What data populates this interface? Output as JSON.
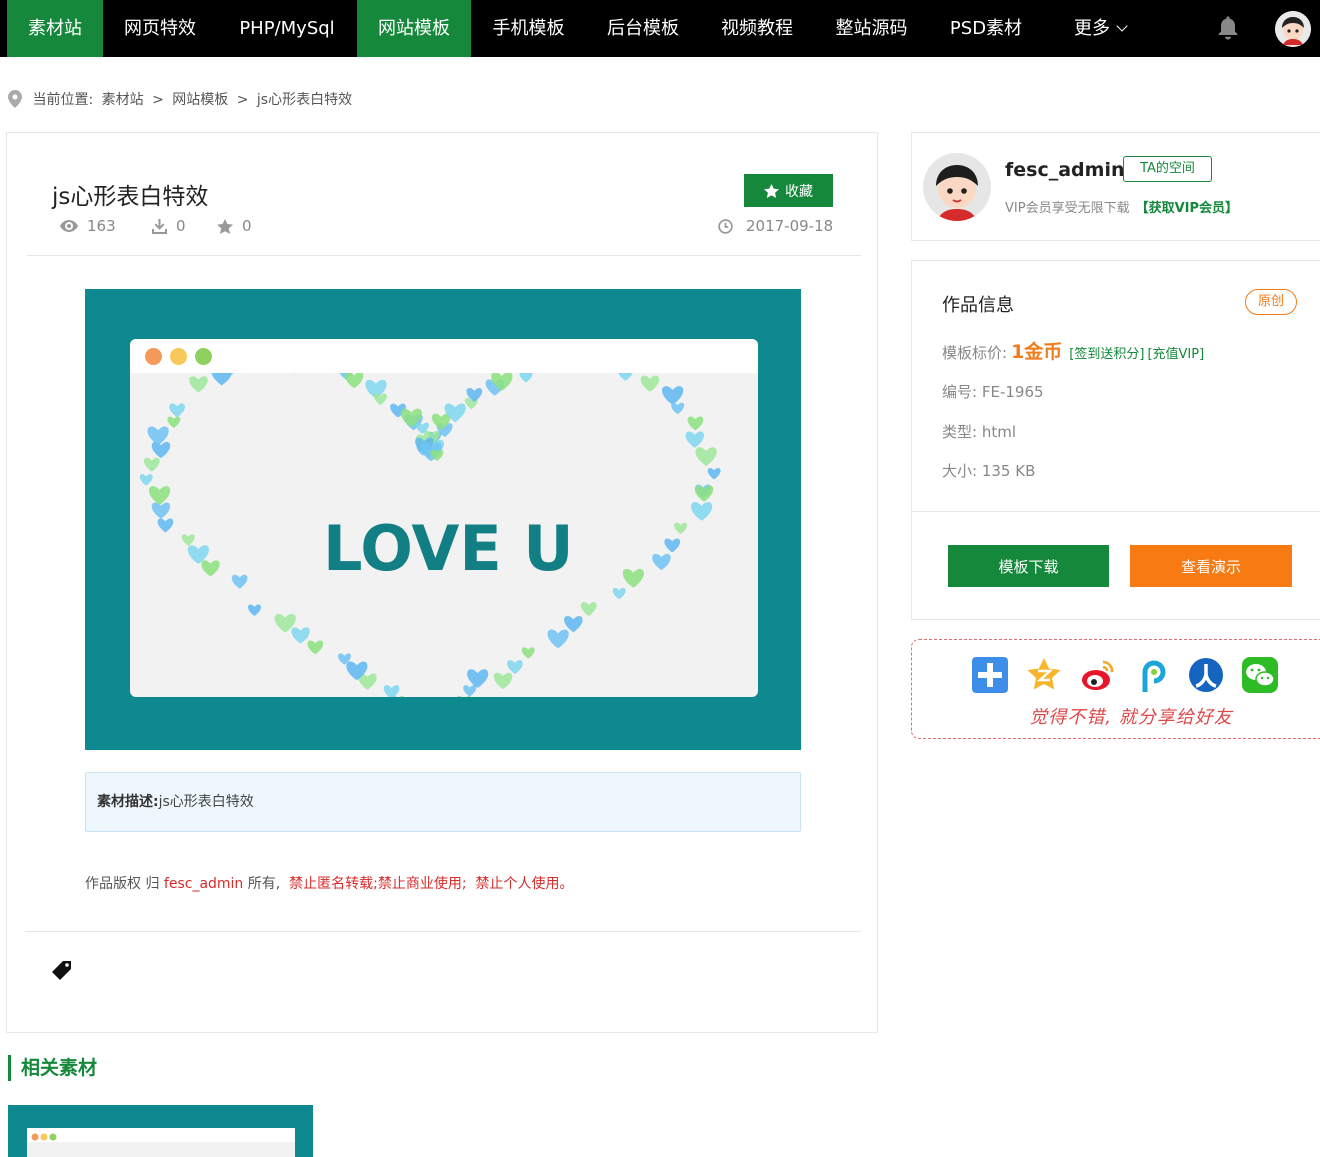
{
  "nav": {
    "items": [
      {
        "label": "素材站",
        "active": true
      },
      {
        "label": "网页特效",
        "active": false
      },
      {
        "label": "PHP/MySql",
        "active": false
      },
      {
        "label": "网站模板",
        "active": true
      },
      {
        "label": "手机模板",
        "active": false
      },
      {
        "label": "后台模板",
        "active": false
      },
      {
        "label": "视频教程",
        "active": false
      },
      {
        "label": "整站源码",
        "active": false
      },
      {
        "label": "PSD素材",
        "active": false
      },
      {
        "label": "更多",
        "active": false
      }
    ],
    "accent": "#15883b"
  },
  "breadcrumb": {
    "prefix": "当前位置:",
    "items": [
      "素材站",
      "网站模板",
      "js心形表白特效"
    ],
    "separator": ">"
  },
  "detail": {
    "title": "js心形表白特效",
    "views": "163",
    "downloads": "0",
    "favorites": "0",
    "fav_label": "收藏",
    "date": "2017-09-18",
    "preview_text": "LOVE U",
    "desc_label": "素材描述:",
    "desc_value": "js心形表白特效",
    "copyright_prefix": "作品版权 归",
    "copyright_owner": "fesc_admin",
    "copyright_suffix": "所有,",
    "copyright_rule1": "禁止匿名转载;禁止商业使用;",
    "copyright_rule2": "禁止个人使用。"
  },
  "related": {
    "title": "相关素材"
  },
  "author": {
    "name": "fesc_admin",
    "space_label": "TA的空间",
    "vip_text": "VIP会员享受无限下载",
    "vip_link": "【获取VIP会员】"
  },
  "info": {
    "title": "作品信息",
    "badge": "原创",
    "price_label": "模板标价:",
    "price_value": "1金币",
    "price_link1": "[签到送积分]",
    "price_link2": "[充值VIP]",
    "id_label": "编号:",
    "id_value": "FE-1965",
    "type_label": "类型:",
    "type_value": "html",
    "size_label": "大小:",
    "size_value": "135 KB",
    "download_label": "模板下载",
    "demo_label": "查看演示"
  },
  "share": {
    "text": "觉得不错, 就分享给好友",
    "icons": [
      "qzone-plus-icon",
      "qq-star-icon",
      "weibo-icon",
      "pengyou-icon",
      "renren-icon",
      "wechat-icon"
    ]
  }
}
